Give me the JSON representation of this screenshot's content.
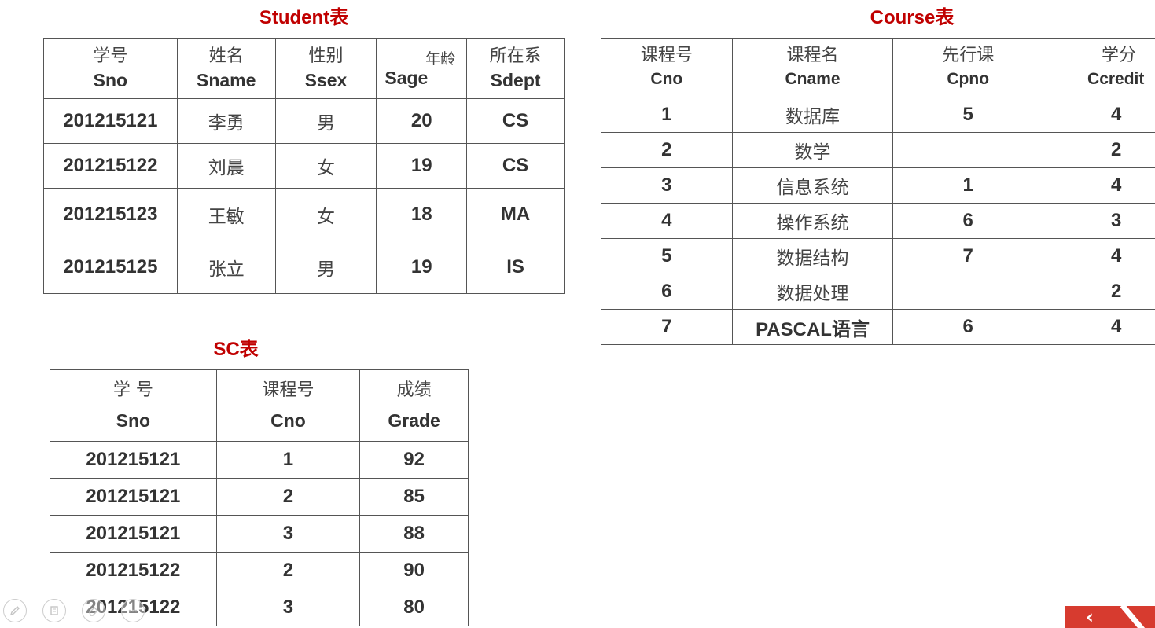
{
  "student": {
    "title": "Student表",
    "headers": [
      {
        "cn": "学号",
        "en": "Sno"
      },
      {
        "cn": "姓名",
        "en": "Sname"
      },
      {
        "cn": "性别",
        "en": "Ssex"
      },
      {
        "cn": "年龄",
        "en": "Sage"
      },
      {
        "cn": "所在系",
        "en": "Sdept"
      }
    ],
    "rows": [
      [
        "201215121",
        "李勇",
        "男",
        "20",
        "CS"
      ],
      [
        "201215122",
        "刘晨",
        "女",
        "19",
        "CS"
      ],
      [
        "201215123",
        "王敏",
        "女",
        "18",
        "MA"
      ],
      [
        "201215125",
        "张立",
        "男",
        "19",
        "IS"
      ]
    ]
  },
  "course": {
    "title": "Course表",
    "headers": [
      {
        "cn": "课程号",
        "en": "Cno"
      },
      {
        "cn": "课程名",
        "en": "Cname"
      },
      {
        "cn": "先行课",
        "en": "Cpno"
      },
      {
        "cn": "学分",
        "en": "Ccredit"
      }
    ],
    "rows": [
      [
        "1",
        "数据库",
        "5",
        "4"
      ],
      [
        "2",
        "数学",
        "",
        "2"
      ],
      [
        "3",
        "信息系统",
        "1",
        "4"
      ],
      [
        "4",
        "操作系统",
        "6",
        "3"
      ],
      [
        "5",
        "数据结构",
        "7",
        "4"
      ],
      [
        "6",
        "数据处理",
        "",
        "2"
      ],
      [
        "7",
        "PASCAL语言",
        "6",
        "4"
      ]
    ]
  },
  "sc": {
    "title": "SC表",
    "headers": [
      {
        "cn": "学 号",
        "en": "Sno"
      },
      {
        "cn": "课程号",
        "en": "Cno"
      },
      {
        "cn": "成绩",
        "en": "Grade"
      }
    ],
    "rows": [
      [
        "201215121",
        "1",
        "92"
      ],
      [
        "201215121",
        "2",
        "85"
      ],
      [
        "201215121",
        "3",
        "88"
      ],
      [
        "201215122",
        "2",
        "90"
      ],
      [
        "201215122",
        "3",
        "80"
      ]
    ]
  },
  "toolbar": {
    "icons": [
      "pen-icon",
      "copy-icon",
      "eraser-icon",
      "more-icon"
    ]
  },
  "nav": {
    "back_glyph": "‹",
    "accent_color": "#d73b2f"
  },
  "colors": {
    "title": "#c00000",
    "text": "#333333",
    "border": "#555555"
  }
}
